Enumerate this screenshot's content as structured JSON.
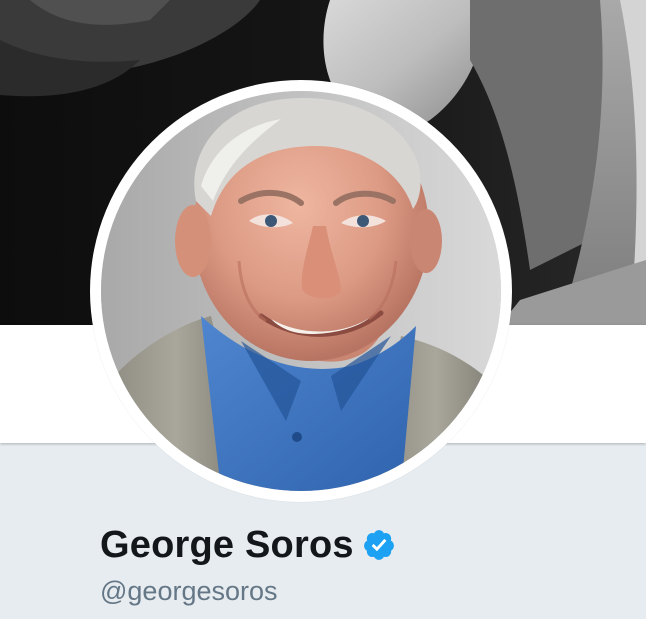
{
  "profile": {
    "name": "George Soros",
    "handle": "@georgesoros",
    "verified": true
  },
  "icons": {
    "verified_badge": "verified-check-icon",
    "avatar": "profile-avatar",
    "banner": "header-banner-image"
  },
  "colors": {
    "page_background": "#e6ecf0",
    "strip_background": "#ffffff",
    "name_color": "#14171a",
    "handle_color": "#657786",
    "verified_color": "#1da1f2"
  }
}
